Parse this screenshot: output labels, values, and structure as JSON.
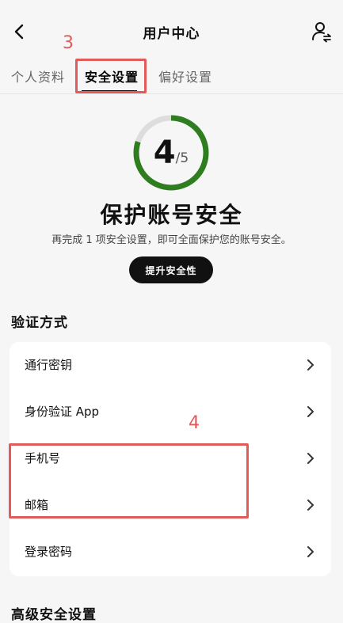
{
  "header": {
    "title": "用户中心",
    "back_icon": "chevron-left-icon",
    "right_icon": "user-switch-icon"
  },
  "annotations": {
    "tab_step": "3",
    "rows_step": "4",
    "color": "#e25b5b"
  },
  "tabs": [
    {
      "label": "个人资料",
      "active": false
    },
    {
      "label": "安全设置",
      "active": true
    },
    {
      "label": "偏好设置",
      "active": false
    }
  ],
  "security_score": {
    "current": "4",
    "total": "/5",
    "progress_fraction": 0.8,
    "ring_color": "#2e7d1f",
    "track_color": "#dddddd"
  },
  "hero": {
    "headline": "保护账号安全",
    "subtitle": "再完成 1 项安全设置，即可全面保护您的账号安全。",
    "button_label": "提升安全性"
  },
  "sections": {
    "verification_title": "验证方式",
    "advanced_title": "高级安全设置"
  },
  "verification_items": [
    {
      "label": "通行密钥"
    },
    {
      "label": "身份验证 App"
    },
    {
      "label": "手机号"
    },
    {
      "label": "邮箱"
    },
    {
      "label": "登录密码"
    }
  ]
}
